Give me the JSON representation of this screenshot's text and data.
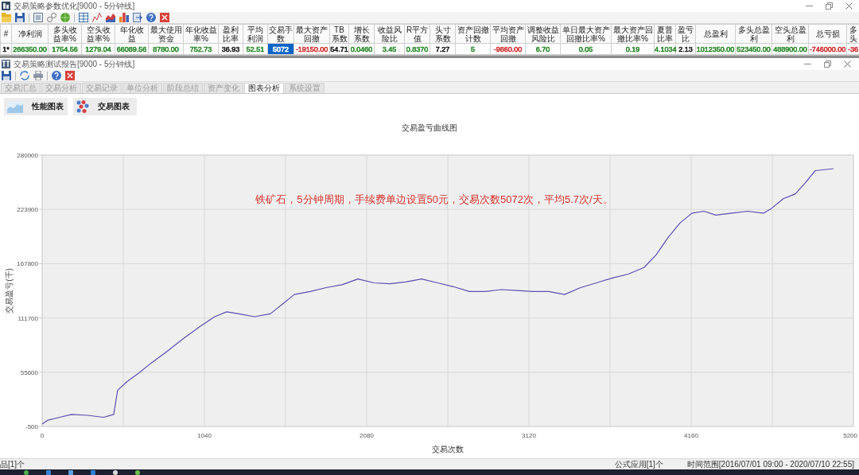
{
  "optimizer_window": {
    "title": "交易策略参数优化[9000 - 5分钟线]",
    "table": {
      "columns": [
        "#",
        "净利润",
        "多头收益率%",
        "空头收益率%",
        "年化收益",
        "最大使用资金",
        "年化收益率%",
        "盈利比率",
        "平均利润",
        "交易手数",
        "最大资产回撤",
        "TB系数",
        "增长系数",
        "收益风险比",
        "R平方值",
        "头寸系数",
        "资产回撤计数",
        "平均资产回撤",
        "调整收益风险比",
        "单日最大资产回撤比率%",
        "最大资产回撤比率%",
        "夏普比率",
        "盈亏比",
        "总盈利",
        "多头总盈利",
        "空头总盈利",
        "总亏损",
        "多头"
      ],
      "rows": [
        {
          "cells": [
            {
              "text": "1*",
              "selected": false
            },
            {
              "text": "266350.00",
              "color": "#2e8b2e",
              "selected": false
            },
            {
              "text": "1754.56",
              "color": "#2e8b2e",
              "selected": false
            },
            {
              "text": "1279.04",
              "color": "#2e8b2e",
              "selected": false
            },
            {
              "text": "66089.56",
              "color": "#2e8b2e",
              "selected": false
            },
            {
              "text": "8780.00",
              "color": "#2e8b2e",
              "selected": false
            },
            {
              "text": "752.73",
              "color": "#2e8b2e",
              "selected": false
            },
            {
              "text": "36.93",
              "color": "#222222",
              "selected": false
            },
            {
              "text": "52.51",
              "color": "#2e8b2e",
              "selected": false
            },
            {
              "text": "5072",
              "selected": true
            },
            {
              "text": "-19150.00",
              "color": "#d03434",
              "selected": false
            },
            {
              "text": "54.71",
              "color": "#222222",
              "selected": false
            },
            {
              "text": "0.0460",
              "color": "#2e8b2e",
              "selected": false
            },
            {
              "text": "3.45",
              "color": "#2e8b2e",
              "selected": false
            },
            {
              "text": "0.8370",
              "color": "#2e8b2e",
              "selected": false
            },
            {
              "text": "7.27",
              "color": "#222222",
              "selected": false
            },
            {
              "text": "5",
              "color": "#2e8b2e",
              "selected": false
            },
            {
              "text": "-9860.00",
              "color": "#d03434",
              "selected": false
            },
            {
              "text": "6.70",
              "color": "#2e8b2e",
              "selected": false
            },
            {
              "text": "0.05",
              "color": "#2e8b2e",
              "selected": false
            },
            {
              "text": "0.19",
              "color": "#2e8b2e",
              "selected": false
            },
            {
              "text": "4.1034",
              "color": "#2e8b2e",
              "selected": false
            },
            {
              "text": "2.13",
              "color": "#222222",
              "selected": false
            },
            {
              "text": "1012350.00",
              "color": "#2e8b2e",
              "selected": false
            },
            {
              "text": "523450.00",
              "color": "#2e8b2e",
              "selected": false
            },
            {
              "text": "488900.00",
              "color": "#2e8b2e",
              "selected": false
            },
            {
              "text": "-746000.00",
              "color": "#d03434",
              "selected": false
            },
            {
              "text": "-36",
              "color": "#d03434",
              "selected": false
            }
          ]
        }
      ]
    }
  },
  "report_window": {
    "title": "交易策略测试报告[9000 - 5分钟线]",
    "tabs": [
      {
        "label": "交易汇总",
        "selected": false
      },
      {
        "label": "交易分析",
        "selected": false
      },
      {
        "label": "交易记录",
        "selected": false
      },
      {
        "label": "单位分析",
        "selected": false
      },
      {
        "label": "阶段总结",
        "selected": false
      },
      {
        "label": "资产变化",
        "selected": false
      },
      {
        "label": "图表分析",
        "selected": true
      },
      {
        "label": "系统设置",
        "selected": false
      }
    ],
    "chart_buttons": [
      {
        "label": "性能图表",
        "kind": "area"
      },
      {
        "label": "交易图表",
        "kind": "scatter"
      }
    ],
    "chart": {
      "chart_data": {
        "type": "line",
        "title": "交易盈亏曲线图",
        "xlabel": "交易次数",
        "ylabel": "交易盈亏(千)",
        "x": [
          0,
          36,
          112,
          189,
          291,
          393,
          459,
          484,
          545,
          622,
          698,
          800,
          902,
          1004,
          1106,
          1183,
          1259,
          1361,
          1463,
          1540,
          1616,
          1718,
          1820,
          1922,
          2024,
          2126,
          2228,
          2330,
          2432,
          2534,
          2636,
          2738,
          2840,
          2942,
          3044,
          3146,
          3247,
          3349,
          3451,
          3553,
          3655,
          3757,
          3859,
          3936,
          4012,
          4089,
          4165,
          4242,
          4318,
          4420,
          4522,
          4624,
          4675,
          4751,
          4828,
          4889,
          4955,
          5072
        ],
        "series": [
          {
            "color": "#5a4fb0",
            "values": [
              2000,
              6000,
              9000,
              12000,
              11000,
              9000,
              12000,
              37000,
              46000,
              55000,
              65000,
              77000,
              90000,
              102000,
              113000,
              118000,
              116000,
              113000,
              116000,
              126000,
              136000,
              139000,
              143000,
              146000,
              152000,
              148000,
              147000,
              149000,
              152000,
              148000,
              144000,
              139000,
              139000,
              141000,
              140000,
              139000,
              139000,
              136000,
              143000,
              148000,
              153000,
              157000,
              164000,
              177000,
              195000,
              210000,
              220000,
              222000,
              218000,
              220000,
              222000,
              220000,
              225000,
              235000,
              240000,
              251000,
              264000,
              266000
            ]
          }
        ],
        "xlim": [
          0,
          5200
        ],
        "ylim": [
          -500,
          280000
        ],
        "xticks": [
          0,
          1040,
          2080,
          3120,
          4160,
          5200
        ],
        "yticks": [
          -500,
          55600,
          111700,
          167800,
          223900,
          280000
        ],
        "grid": true,
        "annotations": [
          "铁矿石，5分钟周期，手续费单边设置50元，交易次数5072次，平均5.7次/天。"
        ]
      }
    }
  },
  "status_bar": {
    "items": [
      "品[1]个",
      "公式应用[1]个",
      "时间范围[2016/07/01 09:00 - 2020/07/10 22:55]"
    ]
  }
}
